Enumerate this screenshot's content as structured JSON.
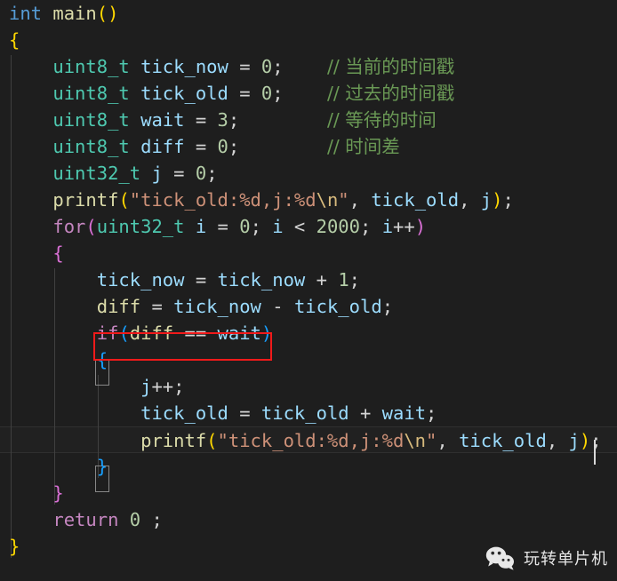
{
  "editor": {
    "language": "c",
    "theme": "Dark+ (Visual Studio Code)",
    "background_color": "#1e1e1e",
    "current_line_color": "#212121",
    "caret_color": "#d8d8d8",
    "highlight_box_color": "#f11a1a",
    "colors": {
      "keyword": "#569cd6",
      "control": "#c586c0",
      "type": "#4ec9b0",
      "variable": "#9cdcfe",
      "function": "#dcdcaa",
      "number": "#b5cea8",
      "string": "#ce9178",
      "escape": "#d7ba7d",
      "operator": "#d4d4d4",
      "comment": "#6a9955",
      "bracket_level_1": "#ffd700",
      "bracket_level_2": "#da70d6",
      "bracket_level_3": "#179fff"
    }
  },
  "code": {
    "lines": [
      "int main()",
      "{",
      "    uint8_t tick_now = 0;    // 当前的时间戳",
      "    uint8_t tick_old = 0;    // 过去的时间戳",
      "    uint8_t wait = 3;        // 等待的时间",
      "    uint8_t diff = 0;        // 时间差",
      "    uint32_t j = 0;",
      "    printf(\"tick_old:%d,j:%d\\n\", tick_old, j);",
      "    for(uint32_t i = 0; i < 2000; i++)",
      "    {",
      "        tick_now = tick_now + 1;",
      "        diff = tick_now - tick_old;",
      "        if(diff == wait)",
      "        {",
      "            j++;",
      "            tick_old = tick_old + wait;",
      "            printf(\"tick_old:%d,j:%d\\n\", tick_old, j);",
      "        }",
      "    }",
      "    return 0 ;",
      "}"
    ],
    "line_count": 20,
    "current_line_index": 16,
    "current_line_text": "            printf(\"tick_old:%d,j:%d\\n\", tick_old, j);",
    "highlighted_line_text": "if(diff == wait)",
    "comments": [
      "// 当前的时间戳",
      "// 过去的时间戳",
      "// 等待的时间",
      "// 时间差"
    ],
    "tokens": {
      "l1": {
        "kw": "int",
        "fn": "main",
        "open": "(",
        "close": ")"
      },
      "l2": {
        "brace": "{"
      },
      "l3": {
        "type": "uint8_t",
        "var": "tick_now",
        "eq": " = ",
        "num": "0",
        "semi": ";",
        "comment": "// 当前的时间戳"
      },
      "l4": {
        "type": "uint8_t",
        "var": "tick_old",
        "eq": " = ",
        "num": "0",
        "semi": ";",
        "comment": "// 过去的时间戳"
      },
      "l5": {
        "type": "uint8_t",
        "var": "wait",
        "eq": " = ",
        "num": "3",
        "semi": ";",
        "comment": "// 等待的时间"
      },
      "l6": {
        "type": "uint8_t",
        "var": "diff",
        "eq": " = ",
        "num": "0",
        "semi": ";",
        "comment": "// 时间差"
      },
      "l7": {
        "type": "uint32_t",
        "var": "j",
        "eq": " = ",
        "num": "0",
        "semi": ";"
      },
      "l8": {
        "fn": "printf",
        "open": "(",
        "str": "\"tick_old:%d,j:%d",
        "esc": "\\n",
        "strend": "\"",
        "comma1": ", ",
        "var1": "tick_old",
        "comma2": ", ",
        "var2": "j",
        "close": ")",
        "semi": ";"
      },
      "l9": {
        "ctrl": "for",
        "open": "(",
        "type": "uint32_t",
        "var": "i",
        "eq": " = ",
        "num1": "0",
        "semi1": "; ",
        "var2": "i",
        "lt": " < ",
        "num2": "2000",
        "semi2": "; ",
        "var3": "i",
        "inc": "++",
        "close": ")"
      },
      "l10": {
        "brace": "{"
      },
      "l11": {
        "var1": "tick_now",
        "eq": " = ",
        "var2": "tick_now",
        "plus": " + ",
        "num": "1",
        "semi": ";"
      },
      "l12": {
        "fn": "diff",
        "eq": " = ",
        "var1": "tick_now",
        "minus": " - ",
        "var2": "tick_old",
        "semi": ";"
      },
      "l13": {
        "ctrl": "if",
        "open": "(",
        "fn": "diff",
        "eqeq": " == ",
        "var": "wait",
        "close": ")"
      },
      "l14": {
        "brace": "{"
      },
      "l15": {
        "var": "j",
        "inc": "++",
        "semi": ";"
      },
      "l16": {
        "var1": "tick_old",
        "eq": " = ",
        "var2": "tick_old",
        "plus": " + ",
        "var3": "wait",
        "semi": ";"
      },
      "l17": {
        "fn": "printf",
        "open": "(",
        "str": "\"tick_old:%d,j:%d",
        "esc": "\\n",
        "strend": "\"",
        "comma1": ", ",
        "var1": "tick_old",
        "comma2": ", ",
        "var2": "j",
        "close": ")",
        "semi": ";"
      },
      "l18": {
        "brace": "}"
      },
      "l19": {
        "brace": "}"
      },
      "l20": {
        "ctrl": "return",
        "num": "0",
        "semi": " ;"
      },
      "l21": {
        "brace": "}"
      }
    }
  },
  "watermark": {
    "icon": "wechat-icon",
    "label": "玩转单片机",
    "color": "#e6e6e6"
  }
}
